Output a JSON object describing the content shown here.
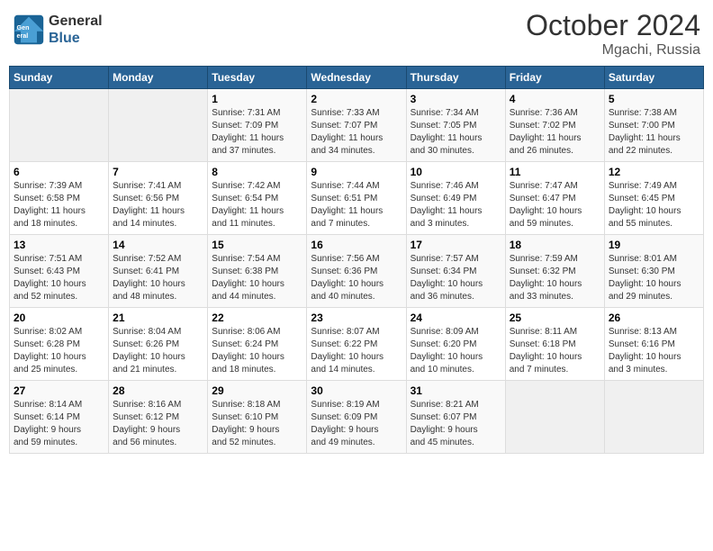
{
  "logo": {
    "line1": "General",
    "line2": "Blue"
  },
  "title": "October 2024",
  "subtitle": "Mgachi, Russia",
  "days_header": [
    "Sunday",
    "Monday",
    "Tuesday",
    "Wednesday",
    "Thursday",
    "Friday",
    "Saturday"
  ],
  "weeks": [
    [
      {
        "day": "",
        "info": ""
      },
      {
        "day": "",
        "info": ""
      },
      {
        "day": "1",
        "info": "Sunrise: 7:31 AM\nSunset: 7:09 PM\nDaylight: 11 hours\nand 37 minutes."
      },
      {
        "day": "2",
        "info": "Sunrise: 7:33 AM\nSunset: 7:07 PM\nDaylight: 11 hours\nand 34 minutes."
      },
      {
        "day": "3",
        "info": "Sunrise: 7:34 AM\nSunset: 7:05 PM\nDaylight: 11 hours\nand 30 minutes."
      },
      {
        "day": "4",
        "info": "Sunrise: 7:36 AM\nSunset: 7:02 PM\nDaylight: 11 hours\nand 26 minutes."
      },
      {
        "day": "5",
        "info": "Sunrise: 7:38 AM\nSunset: 7:00 PM\nDaylight: 11 hours\nand 22 minutes."
      }
    ],
    [
      {
        "day": "6",
        "info": "Sunrise: 7:39 AM\nSunset: 6:58 PM\nDaylight: 11 hours\nand 18 minutes."
      },
      {
        "day": "7",
        "info": "Sunrise: 7:41 AM\nSunset: 6:56 PM\nDaylight: 11 hours\nand 14 minutes."
      },
      {
        "day": "8",
        "info": "Sunrise: 7:42 AM\nSunset: 6:54 PM\nDaylight: 11 hours\nand 11 minutes."
      },
      {
        "day": "9",
        "info": "Sunrise: 7:44 AM\nSunset: 6:51 PM\nDaylight: 11 hours\nand 7 minutes."
      },
      {
        "day": "10",
        "info": "Sunrise: 7:46 AM\nSunset: 6:49 PM\nDaylight: 11 hours\nand 3 minutes."
      },
      {
        "day": "11",
        "info": "Sunrise: 7:47 AM\nSunset: 6:47 PM\nDaylight: 10 hours\nand 59 minutes."
      },
      {
        "day": "12",
        "info": "Sunrise: 7:49 AM\nSunset: 6:45 PM\nDaylight: 10 hours\nand 55 minutes."
      }
    ],
    [
      {
        "day": "13",
        "info": "Sunrise: 7:51 AM\nSunset: 6:43 PM\nDaylight: 10 hours\nand 52 minutes."
      },
      {
        "day": "14",
        "info": "Sunrise: 7:52 AM\nSunset: 6:41 PM\nDaylight: 10 hours\nand 48 minutes."
      },
      {
        "day": "15",
        "info": "Sunrise: 7:54 AM\nSunset: 6:38 PM\nDaylight: 10 hours\nand 44 minutes."
      },
      {
        "day": "16",
        "info": "Sunrise: 7:56 AM\nSunset: 6:36 PM\nDaylight: 10 hours\nand 40 minutes."
      },
      {
        "day": "17",
        "info": "Sunrise: 7:57 AM\nSunset: 6:34 PM\nDaylight: 10 hours\nand 36 minutes."
      },
      {
        "day": "18",
        "info": "Sunrise: 7:59 AM\nSunset: 6:32 PM\nDaylight: 10 hours\nand 33 minutes."
      },
      {
        "day": "19",
        "info": "Sunrise: 8:01 AM\nSunset: 6:30 PM\nDaylight: 10 hours\nand 29 minutes."
      }
    ],
    [
      {
        "day": "20",
        "info": "Sunrise: 8:02 AM\nSunset: 6:28 PM\nDaylight: 10 hours\nand 25 minutes."
      },
      {
        "day": "21",
        "info": "Sunrise: 8:04 AM\nSunset: 6:26 PM\nDaylight: 10 hours\nand 21 minutes."
      },
      {
        "day": "22",
        "info": "Sunrise: 8:06 AM\nSunset: 6:24 PM\nDaylight: 10 hours\nand 18 minutes."
      },
      {
        "day": "23",
        "info": "Sunrise: 8:07 AM\nSunset: 6:22 PM\nDaylight: 10 hours\nand 14 minutes."
      },
      {
        "day": "24",
        "info": "Sunrise: 8:09 AM\nSunset: 6:20 PM\nDaylight: 10 hours\nand 10 minutes."
      },
      {
        "day": "25",
        "info": "Sunrise: 8:11 AM\nSunset: 6:18 PM\nDaylight: 10 hours\nand 7 minutes."
      },
      {
        "day": "26",
        "info": "Sunrise: 8:13 AM\nSunset: 6:16 PM\nDaylight: 10 hours\nand 3 minutes."
      }
    ],
    [
      {
        "day": "27",
        "info": "Sunrise: 8:14 AM\nSunset: 6:14 PM\nDaylight: 9 hours\nand 59 minutes."
      },
      {
        "day": "28",
        "info": "Sunrise: 8:16 AM\nSunset: 6:12 PM\nDaylight: 9 hours\nand 56 minutes."
      },
      {
        "day": "29",
        "info": "Sunrise: 8:18 AM\nSunset: 6:10 PM\nDaylight: 9 hours\nand 52 minutes."
      },
      {
        "day": "30",
        "info": "Sunrise: 8:19 AM\nSunset: 6:09 PM\nDaylight: 9 hours\nand 49 minutes."
      },
      {
        "day": "31",
        "info": "Sunrise: 8:21 AM\nSunset: 6:07 PM\nDaylight: 9 hours\nand 45 minutes."
      },
      {
        "day": "",
        "info": ""
      },
      {
        "day": "",
        "info": ""
      }
    ]
  ]
}
